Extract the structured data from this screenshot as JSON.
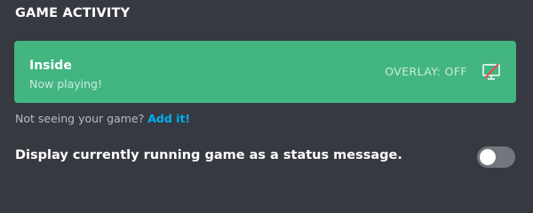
{
  "section": {
    "title": "GAME ACTIVITY"
  },
  "game_card": {
    "name": "Inside",
    "status": "Now playing!",
    "overlay_status": "OVERLAY: OFF",
    "overlay_icon": "monitor-off-icon",
    "background_color": "#43b581"
  },
  "helper": {
    "prefix": "Not seeing your game?",
    "link_label": "Add it!",
    "link_color": "#00b0f4"
  },
  "setting": {
    "label": "Display currently running game as a status message.",
    "enabled": false
  }
}
